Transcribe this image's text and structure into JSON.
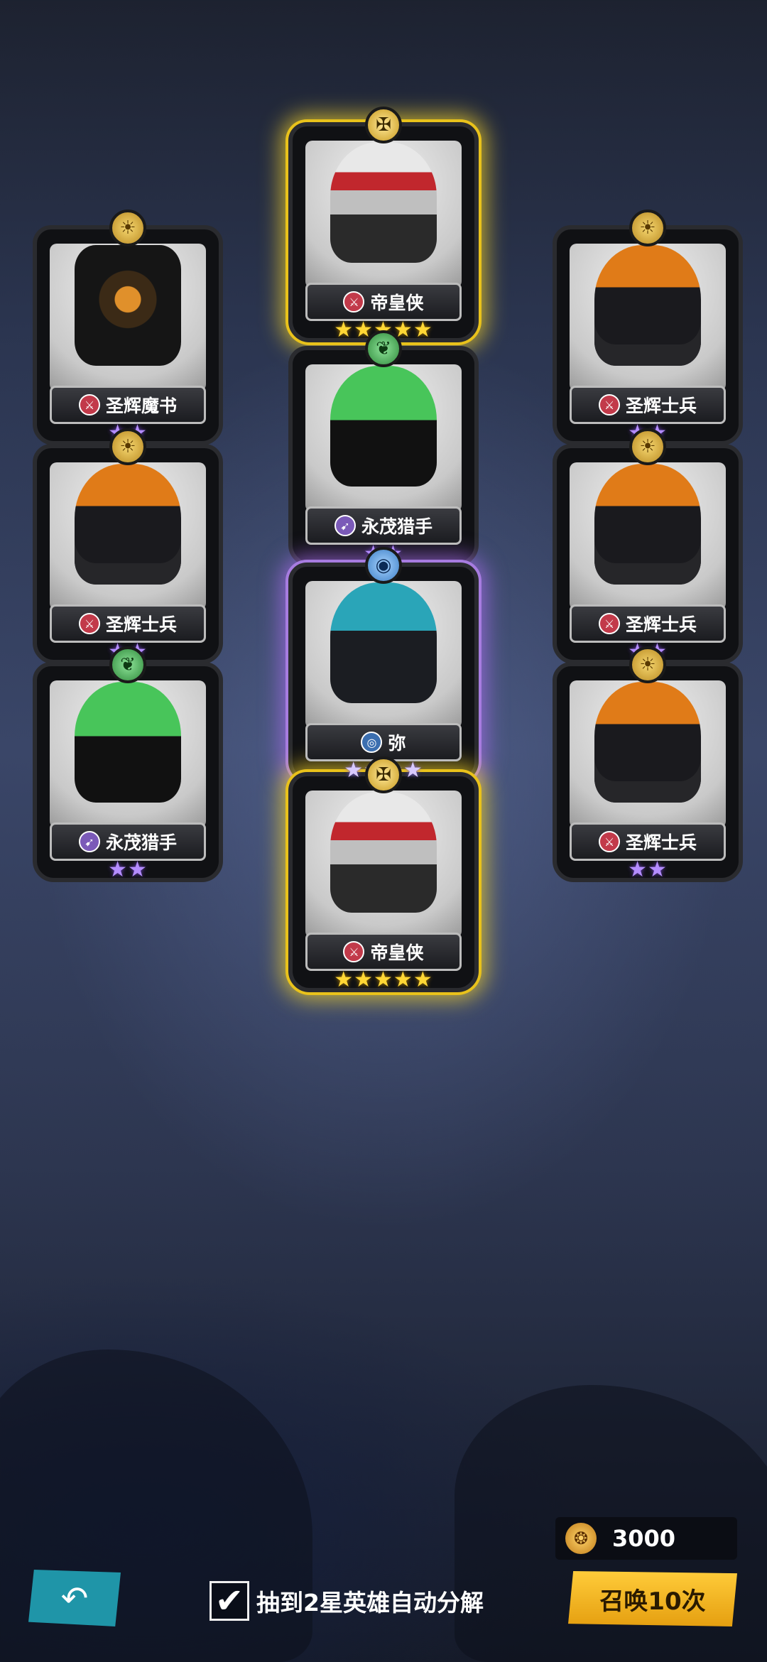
{
  "cards": [
    {
      "id": "c1",
      "name": "帝皇侠",
      "stars": "★★★★★",
      "rarity": "gold",
      "emblem": "✠",
      "cls": "⚔"
    },
    {
      "id": "c2",
      "name": "圣辉魔书",
      "stars": "★★",
      "rarity": "normal",
      "emblem": "☀",
      "cls": "⚔"
    },
    {
      "id": "c3",
      "name": "圣辉士兵",
      "stars": "★★",
      "rarity": "normal",
      "emblem": "☀",
      "cls": "⚔"
    },
    {
      "id": "c4",
      "name": "永茂猎手",
      "stars": "★★",
      "rarity": "normal",
      "emblem": "❦",
      "cls": "➹"
    },
    {
      "id": "c5",
      "name": "圣辉士兵",
      "stars": "★★",
      "rarity": "normal",
      "emblem": "☀",
      "cls": "⚔"
    },
    {
      "id": "c6",
      "name": "圣辉士兵",
      "stars": "★★",
      "rarity": "normal",
      "emblem": "☀",
      "cls": "⚔"
    },
    {
      "id": "c7",
      "name": "弥",
      "stars": "★★★★",
      "rarity": "purple",
      "emblem": "◉",
      "cls": "◎"
    },
    {
      "id": "c8",
      "name": "永茂猎手",
      "stars": "★★",
      "rarity": "normal",
      "emblem": "❦",
      "cls": "➹"
    },
    {
      "id": "c9",
      "name": "圣辉士兵",
      "stars": "★★",
      "rarity": "normal",
      "emblem": "☀",
      "cls": "⚔"
    },
    {
      "id": "c10",
      "name": "帝皇侠",
      "stars": "★★★★★",
      "rarity": "gold",
      "emblem": "✠",
      "cls": "⚔"
    }
  ],
  "footer": {
    "back_icon": "↶",
    "auto_check": "✔",
    "auto_label": "抽到2星英雄自动分解",
    "currency_icon": "❂",
    "currency_value": "3000",
    "summon_label": "召唤10次"
  }
}
